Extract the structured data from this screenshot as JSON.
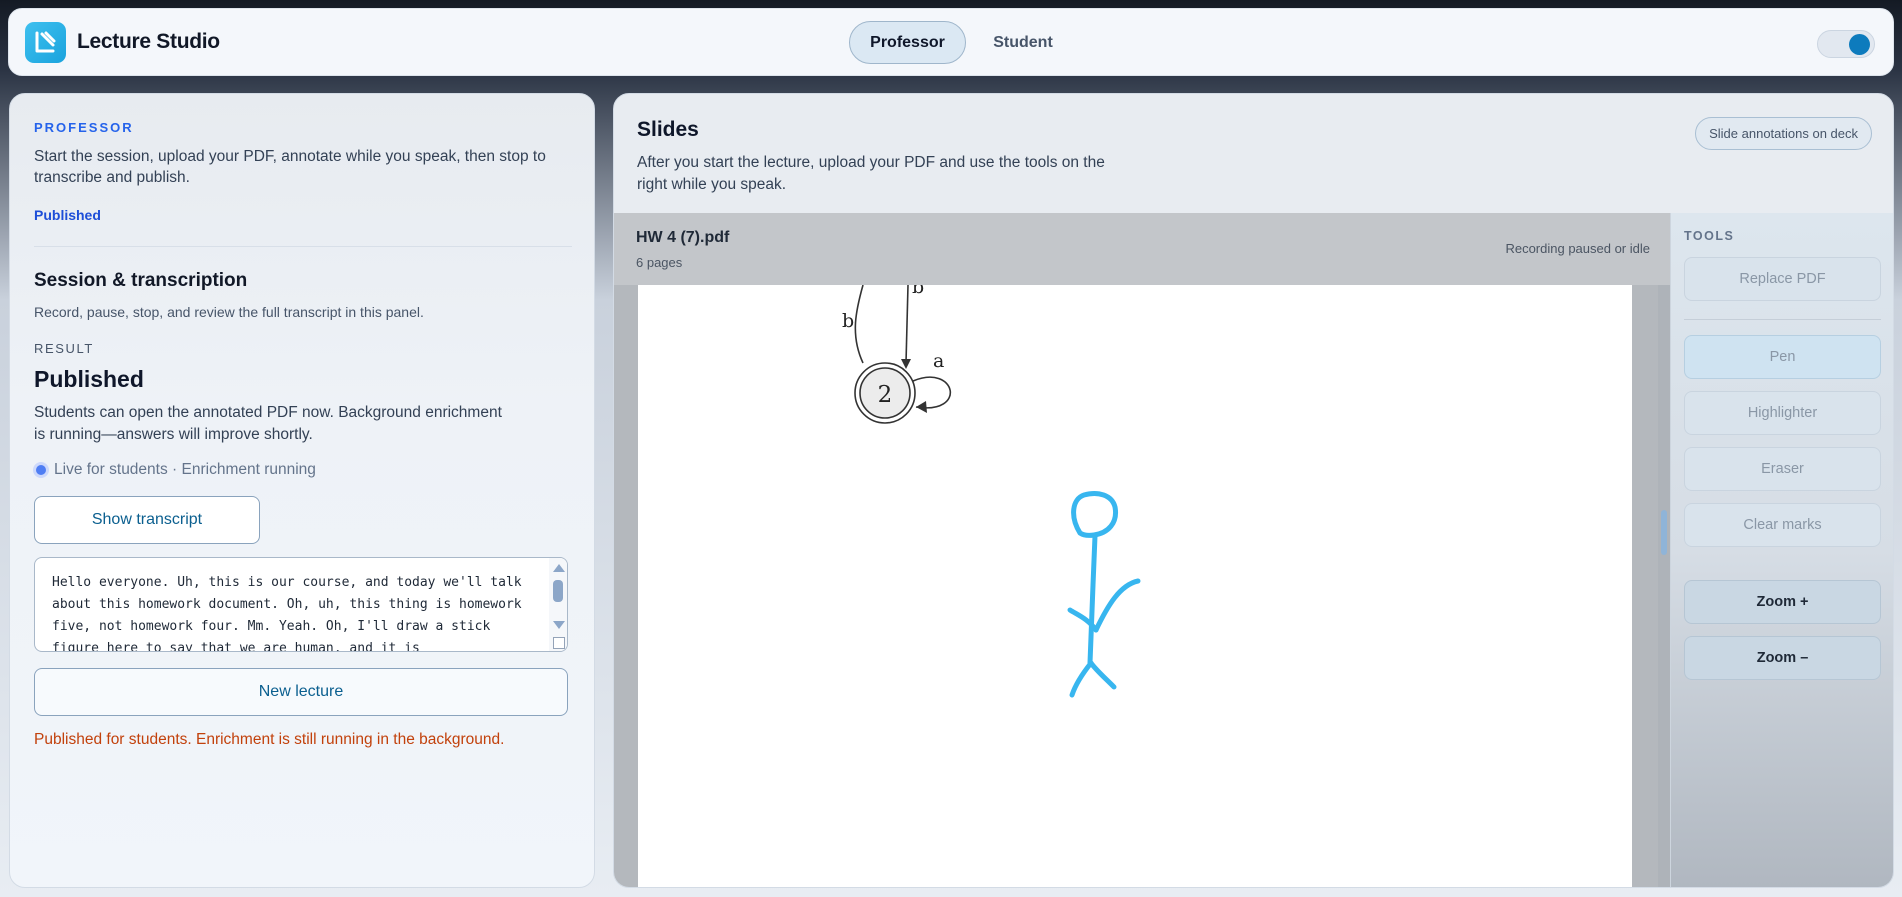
{
  "app": {
    "title": "Lecture Studio",
    "brand_color": "#1aa3dd"
  },
  "header": {
    "roles": [
      {
        "label": "Professor",
        "active": true
      },
      {
        "label": "Student",
        "active": false
      }
    ],
    "theme_toggle_on": true
  },
  "left_panel": {
    "eyebrow": "PROFESSOR",
    "intro": "Start the session, upload your PDF, annotate while you speak, then stop to transcribe and publish.",
    "status": "Published",
    "section_title": "Session & transcription",
    "section_desc": "Record, pause, stop, and review the full transcript in this panel.",
    "result_label": "RESULT",
    "result_title": "Published",
    "result_desc": "Students can open the annotated PDF now. Background enrichment is running—answers will improve shortly.",
    "live_status": "Live for students · Enrichment running",
    "show_transcript_label": "Show transcript",
    "transcript_text": "Hello everyone. Uh, this is our course, and today we'll talk about this homework document. Oh, uh, this thing is homework five, not homework four. Mm. Yeah. Oh, I'll draw a stick figure here to say that we are human, and it is",
    "new_lecture_label": "New lecture",
    "notice": "Published for students. Enrichment is still running in the background.",
    "notice_color": "#c2410c"
  },
  "slides": {
    "title": "Slides",
    "desc": "After you start the lecture, upload your PDF and use the tools on the right while you speak.",
    "badge": "Slide annotations on deck",
    "file_name": "HW 4 (7).pdf",
    "file_pages": "6 pages",
    "recording_status": "Recording paused or idle",
    "diagram": {
      "state_label": "2",
      "edge_labels": [
        "b",
        "b",
        "a"
      ]
    },
    "annotation_color": "#38b6ef"
  },
  "tools": {
    "label": "TOOLS",
    "replace_pdf": "Replace PDF",
    "pen": "Pen",
    "highlighter": "Highlighter",
    "eraser": "Eraser",
    "clear_marks": "Clear marks",
    "zoom_in": "Zoom +",
    "zoom_out": "Zoom –"
  }
}
